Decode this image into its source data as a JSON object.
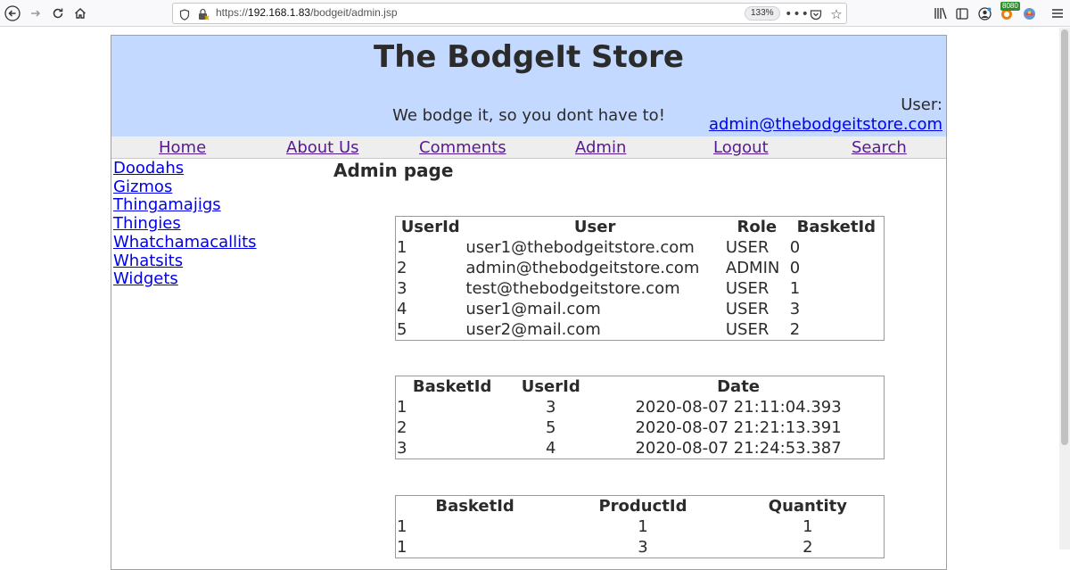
{
  "browser": {
    "url_prefix": "https://",
    "url_host": "192.168.1.83",
    "url_path": "/bodgeit/admin.jsp",
    "zoom": "133%",
    "extension_badge": "8080"
  },
  "header": {
    "title": "The BodgeIt Store",
    "tagline": "We bodge it, so you dont have to!",
    "user_label": "User:",
    "user_email": "admin@thebodgeitstore.com"
  },
  "nav": [
    {
      "label": "Home"
    },
    {
      "label": "About Us"
    },
    {
      "label": "Comments"
    },
    {
      "label": "Admin"
    },
    {
      "label": "Logout"
    },
    {
      "label": "Search"
    }
  ],
  "sidebar": [
    {
      "label": "Doodahs"
    },
    {
      "label": "Gizmos"
    },
    {
      "label": "Thingamajigs"
    },
    {
      "label": "Thingies"
    },
    {
      "label": "Whatchamacallits"
    },
    {
      "label": "Whatsits"
    },
    {
      "label": "Widgets"
    }
  ],
  "main": {
    "heading": "Admin page",
    "users_table": {
      "headers": [
        "UserId",
        "User",
        "Role",
        "BasketId"
      ],
      "rows": [
        [
          "1",
          "user1@thebodgeitstore.com",
          "USER",
          "0"
        ],
        [
          "2",
          "admin@thebodgeitstore.com",
          "ADMIN",
          "0"
        ],
        [
          "3",
          "test@thebodgeitstore.com",
          "USER",
          "1"
        ],
        [
          "4",
          "user1@mail.com",
          "USER",
          "3"
        ],
        [
          "5",
          "user2@mail.com",
          "USER",
          "2"
        ]
      ]
    },
    "baskets_table": {
      "headers": [
        "BasketId",
        "UserId",
        "Date"
      ],
      "rows": [
        [
          "1",
          "3",
          "2020-08-07 21:11:04.393"
        ],
        [
          "2",
          "5",
          "2020-08-07 21:21:13.391"
        ],
        [
          "3",
          "4",
          "2020-08-07 21:24:53.387"
        ]
      ]
    },
    "basket_contents_table": {
      "headers": [
        "BasketId",
        "ProductId",
        "Quantity"
      ],
      "rows": [
        [
          "1",
          "1",
          "1"
        ],
        [
          "1",
          "3",
          "2"
        ]
      ]
    }
  }
}
